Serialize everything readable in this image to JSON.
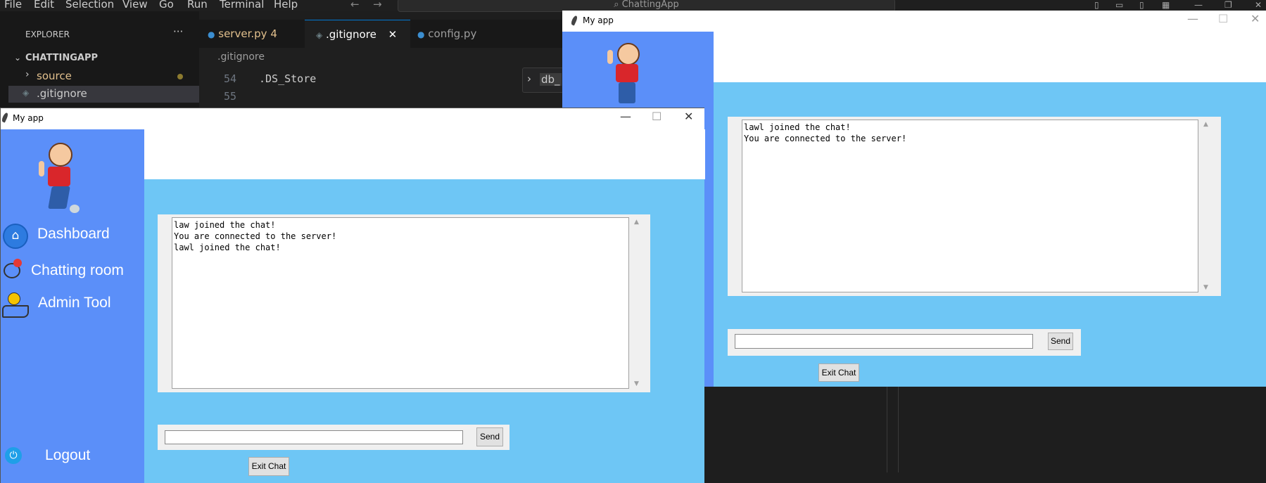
{
  "vscode": {
    "menu": [
      "File",
      "Edit",
      "Selection",
      "View",
      "Go",
      "Run",
      "Terminal",
      "Help"
    ],
    "search_text": "ChattingApp",
    "explorer_title": "EXPLORER",
    "explorer_more": "···",
    "project_name": "CHATTINGAPP",
    "tree": [
      {
        "label": "source",
        "color": "#e2c08d"
      },
      {
        "label": ".gitignore",
        "color": "#cccccc"
      }
    ],
    "tabs": [
      {
        "label": "server.py",
        "badge": "4"
      },
      {
        "label": ".gitignore",
        "close": "✕"
      },
      {
        "label": "config.py"
      }
    ],
    "breadcrumb": ".gitignore",
    "lines": [
      {
        "num": "54",
        "text": ".DS_Store"
      },
      {
        "num": "55",
        "text": ""
      }
    ],
    "peek_label": "db_"
  },
  "left_window": {
    "title": "My app",
    "controls": {
      "minimize": "—",
      "maximize": "☐",
      "close": "✕"
    },
    "nav": [
      {
        "label": "Dashboard",
        "icon": "home-icon"
      },
      {
        "label": "Chatting room",
        "icon": "chat-icon"
      },
      {
        "label": "Admin Tool",
        "icon": "key-hand-icon"
      }
    ],
    "logout_label": "Logout",
    "chat_lines": "law joined the chat!\nYou are connected to the server!\nlawl joined the chat!",
    "message_value": "",
    "send_label": "Send",
    "exit_label": "Exit Chat",
    "colors": {
      "sidebar": "#5b8ff9",
      "main": "#6ec6f5"
    }
  },
  "right_window": {
    "title": "My app",
    "controls": {
      "minimize": "—",
      "maximize": "☐",
      "close": "✕"
    },
    "chat_lines": "lawl joined the chat!\nYou are connected to the server!",
    "message_value": "",
    "send_label": "Send",
    "exit_label": "Exit Chat"
  }
}
